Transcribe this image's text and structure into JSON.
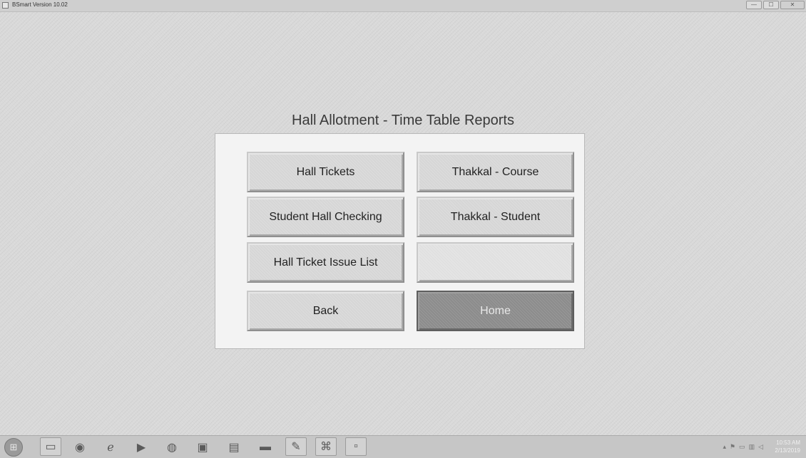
{
  "window": {
    "title": "BSmart Version 10.02",
    "controls": {
      "minimize": "—",
      "maximize": "☐",
      "close": "✕"
    }
  },
  "heading": "Hall Allotment - Time Table  Reports",
  "buttons": {
    "hall_tickets": "Hall Tickets",
    "thakkal_course": "Thakkal - Course",
    "student_hall_checking": "Student Hall Checking",
    "thakkal_student": "Thakkal - Student",
    "hall_ticket_issue_list": "Hall Ticket Issue List",
    "empty": "",
    "back": "Back",
    "home": "Home"
  },
  "taskbar": {
    "icons": [
      "windows-start-icon",
      "file-explorer-icon",
      "chrome-icon",
      "internet-explorer-icon",
      "media-player-icon",
      "browser-icon",
      "pdf-reader-icon",
      "document-icon",
      "folder-icon",
      "text-editor-icon",
      "network-app-icon",
      "app-window-icon"
    ],
    "clock_time": "10:53 AM",
    "clock_date": "2/13/2019"
  }
}
